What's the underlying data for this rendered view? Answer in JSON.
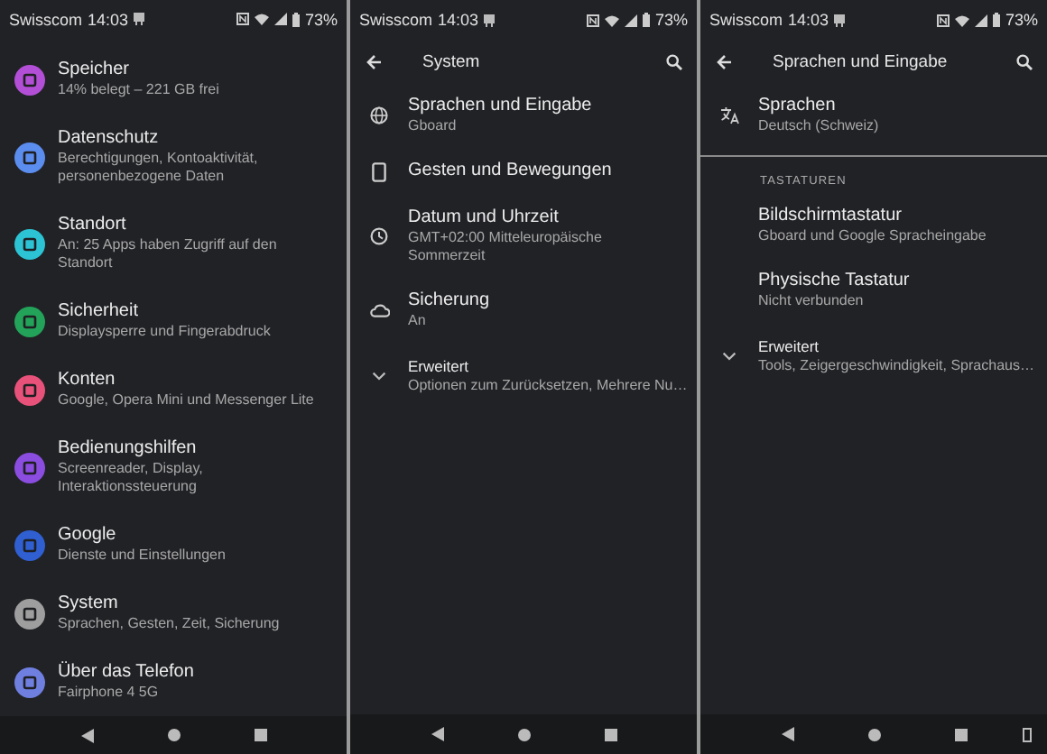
{
  "screens": [
    {
      "status": {
        "carrier": "Swisscom",
        "time": "14:03",
        "battery": "73%"
      },
      "nav_extra": false,
      "items": [
        {
          "kind": "category",
          "title": "Speicher",
          "subtitle": "14% belegt – 221 GB frei",
          "color": "#b34fd6"
        },
        {
          "kind": "category",
          "title": "Datenschutz",
          "subtitle": "Berechtigungen, Kontoaktivität, personenbezogene Daten",
          "color": "#5b8def"
        },
        {
          "kind": "category",
          "title": "Standort",
          "subtitle": "An: 25 Apps haben Zugriff auf den Standort",
          "color": "#2cc4d4"
        },
        {
          "kind": "category",
          "title": "Sicherheit",
          "subtitle": "Displaysperre und Fingerabdruck",
          "color": "#23a35a"
        },
        {
          "kind": "category",
          "title": "Konten",
          "subtitle": "Google, Opera Mini und Messenger Lite",
          "color": "#e8527a"
        },
        {
          "kind": "category",
          "title": "Bedienungshilfen",
          "subtitle": "Screenreader, Display, Interaktionssteuerung",
          "color": "#8a4de0"
        },
        {
          "kind": "category",
          "title": "Google",
          "subtitle": "Dienste und Einstellungen",
          "color": "#2f5fd0"
        },
        {
          "kind": "category",
          "title": "System",
          "subtitle": "Sprachen, Gesten, Zeit, Sicherung",
          "color": "#9e9e9e"
        },
        {
          "kind": "category",
          "title": "Über das Telefon",
          "subtitle": "Fairphone 4 5G",
          "color": "#6f7fe0"
        }
      ]
    },
    {
      "status": {
        "carrier": "Swisscom",
        "time": "14:03",
        "battery": "73%"
      },
      "header": "System",
      "nav_extra": false,
      "items": [
        {
          "kind": "globe",
          "title": "Sprachen und Eingabe",
          "subtitle": "Gboard"
        },
        {
          "kind": "phone",
          "title": "Gesten und Bewegungen"
        },
        {
          "kind": "clock",
          "title": "Datum und Uhrzeit",
          "subtitle": "GMT+02:00 Mitteleuropäische Sommerzeit"
        },
        {
          "kind": "cloud",
          "title": "Sicherung",
          "subtitle": "An"
        },
        {
          "kind": "expander",
          "title": "Erweitert",
          "subtitle": "Optionen zum Zurücksetzen, Mehrere Nu…"
        }
      ]
    },
    {
      "status": {
        "carrier": "Swisscom",
        "time": "14:03",
        "battery": "73%"
      },
      "header": "Sprachen und Eingabe",
      "nav_extra": true,
      "items": [
        {
          "kind": "translate",
          "title": "Sprachen",
          "subtitle": "Deutsch (Schweiz)"
        },
        {
          "kind": "divider"
        },
        {
          "kind": "section",
          "title": "TASTATUREN"
        },
        {
          "kind": "plain",
          "title": "Bildschirmtastatur",
          "subtitle": "Gboard und Google Spracheingabe"
        },
        {
          "kind": "plain",
          "title": "Physische Tastatur",
          "subtitle": "Nicht verbunden"
        },
        {
          "kind": "expander",
          "title": "Erweitert",
          "subtitle": "Tools, Zeigergeschwindigkeit, Sprachaus…"
        }
      ]
    }
  ]
}
